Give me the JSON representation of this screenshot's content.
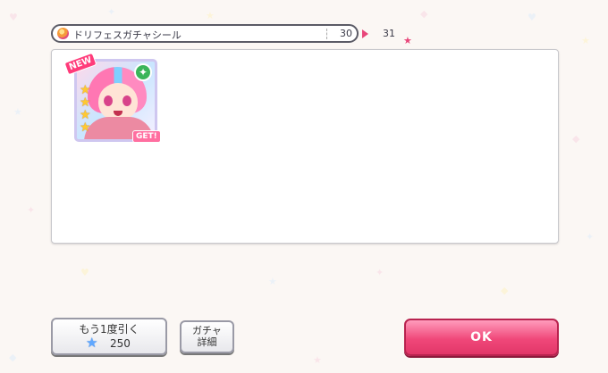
{
  "ticket": {
    "name": "ドリフェスガチャシール",
    "count_from": "30",
    "count_to": "31",
    "icon": "ticket-icon"
  },
  "result_card": {
    "new_label": "NEW",
    "get_label": "GET!",
    "rarity_stars": 4,
    "attribute_icon": "pure-attribute-icon"
  },
  "buttons": {
    "again_label": "もう1度引く",
    "again_cost": "250",
    "again_cost_icon": "star-icon",
    "detail_label": "ガチャ\n詳細",
    "ok_label": "OK"
  },
  "colors": {
    "accent": "#e8467a",
    "ok_button": "#f0487a",
    "star": "#ffc832",
    "attribute": "#3bb55a"
  }
}
